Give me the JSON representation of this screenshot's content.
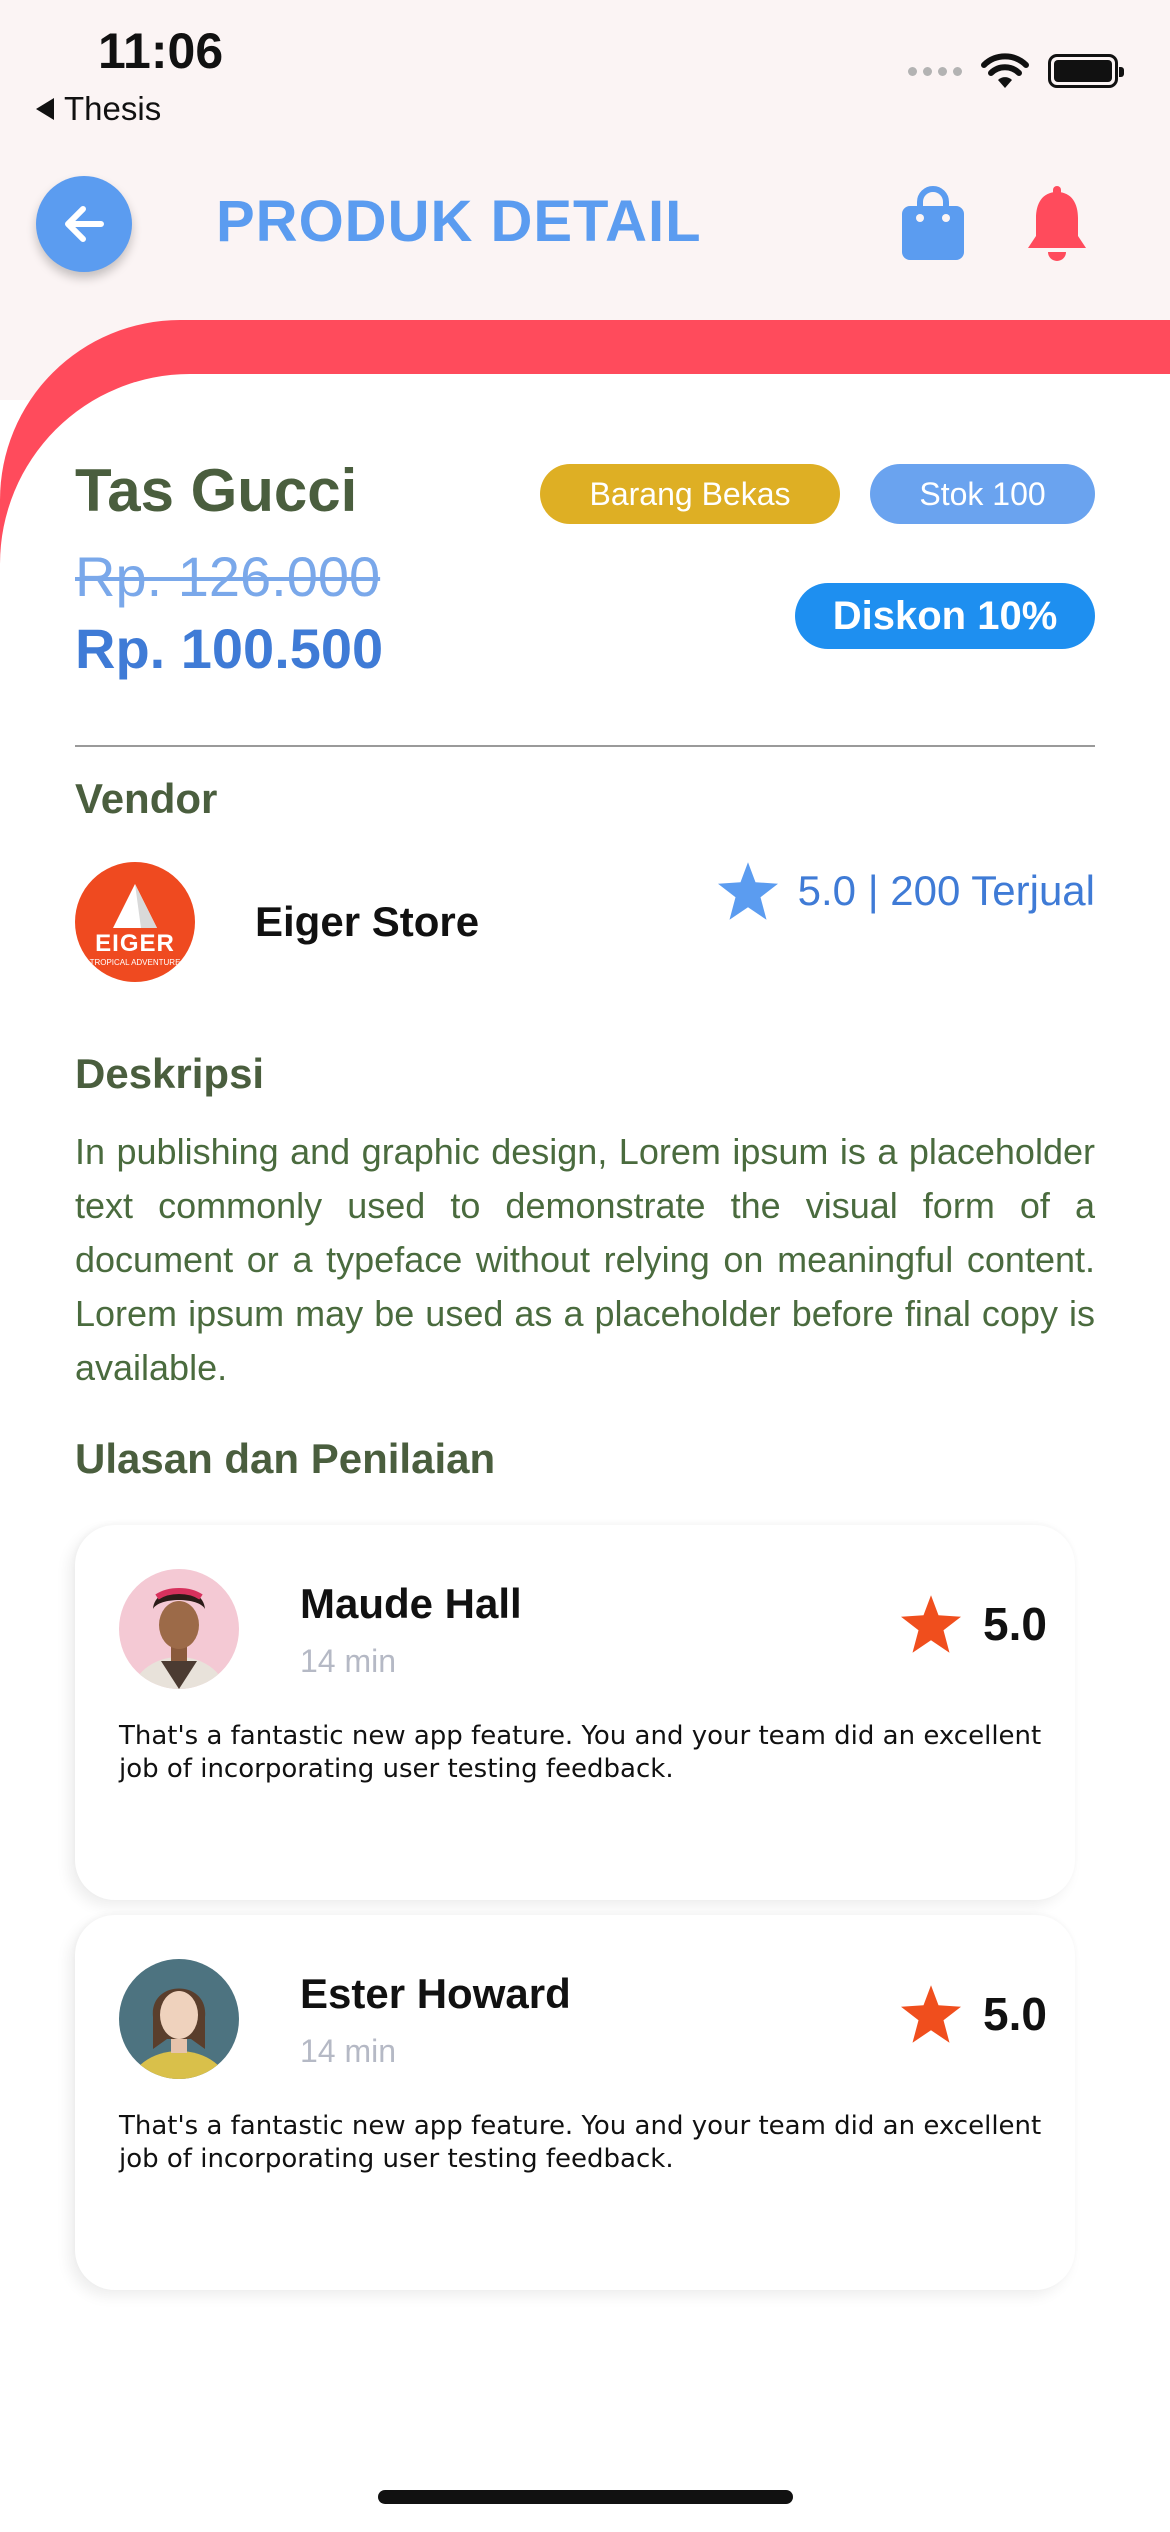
{
  "status_bar": {
    "time": "11:06",
    "back_app": "Thesis"
  },
  "header": {
    "title": "PRODUK DETAIL",
    "icons": [
      "back-arrow-icon",
      "shopping-bag-icon",
      "bell-icon"
    ],
    "colors": {
      "accent": "#5b9cf0",
      "bell": "#ff4b5c"
    }
  },
  "product": {
    "name": "Tas Gucci",
    "condition": "Barang Bekas",
    "stock": "Stok 100",
    "old_price": "Rp. 126.000",
    "price": "Rp. 100.500",
    "discount": "Diskon 10%"
  },
  "vendor": {
    "heading": "Vendor",
    "logo_text": "EIGER",
    "logo_subtext": "TROPICAL ADVENTURE",
    "name": "Eiger Store",
    "stats": "5.0 | 200 Terjual"
  },
  "description": {
    "heading": "Deskripsi",
    "text": "In publishing and graphic design, Lorem ipsum is a placeholder text commonly used to demonstrate the visual form of a document or a typeface without relying on meaningful content. Lorem ipsum may be used as a placeholder before final copy is available."
  },
  "reviews": {
    "heading": "Ulasan dan Penilaian",
    "items": [
      {
        "name": "Maude Hall",
        "time": "14 min",
        "rating": "5.0",
        "text": "That's a fantastic new app feature. You and your team did an excellent job of incorporating user testing feedback."
      },
      {
        "name": "Ester Howard",
        "time": "14 min",
        "rating": "5.0",
        "text": "That's a fantastic new app feature. You and your team did an excellent job of incorporating user testing feedback."
      }
    ]
  }
}
